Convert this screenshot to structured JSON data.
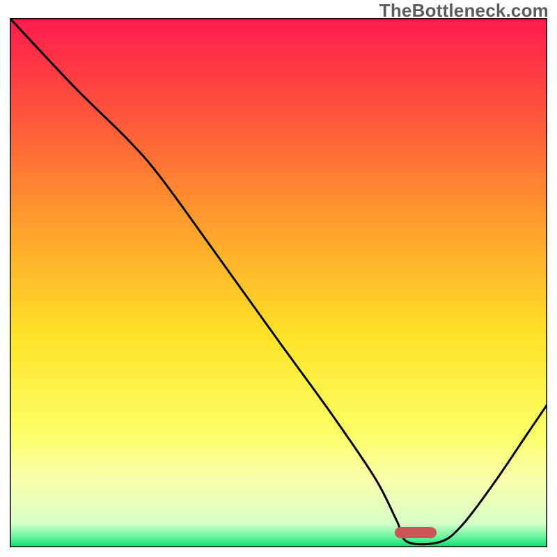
{
  "watermark": "TheBottleneck.com",
  "marker": {
    "x_frac": 0.755,
    "y_frac": 0.972,
    "color": "#cb5658"
  },
  "chart_data": {
    "type": "line",
    "title": "",
    "xlabel": "",
    "ylabel": "",
    "xlim": [
      0,
      1
    ],
    "ylim": [
      0,
      1
    ],
    "background_gradient": {
      "top": "#ff1c4e",
      "mid_top": "#ff8b2d",
      "mid": "#ffe324",
      "mid_low": "#faff60",
      "low_band": "#f6ffa9",
      "bottom": "#00e e? "
    },
    "gradient_stops": [
      {
        "offset": 0.0,
        "color": "#ff1b4d"
      },
      {
        "offset": 0.2,
        "color": "#ff5a3a"
      },
      {
        "offset": 0.4,
        "color": "#ffa22c"
      },
      {
        "offset": 0.6,
        "color": "#ffe227"
      },
      {
        "offset": 0.78,
        "color": "#fbff62"
      },
      {
        "offset": 0.88,
        "color": "#f7ffb0"
      },
      {
        "offset": 0.955,
        "color": "#d4ffc6"
      },
      {
        "offset": 0.98,
        "color": "#6df59e"
      },
      {
        "offset": 1.0,
        "color": "#00e06a"
      }
    ],
    "series": [
      {
        "name": "curve",
        "points": [
          {
            "x": 0.0,
            "y": 1.0
          },
          {
            "x": 0.12,
            "y": 0.87
          },
          {
            "x": 0.22,
            "y": 0.77
          },
          {
            "x": 0.28,
            "y": 0.7
          },
          {
            "x": 0.38,
            "y": 0.56
          },
          {
            "x": 0.5,
            "y": 0.39
          },
          {
            "x": 0.6,
            "y": 0.25
          },
          {
            "x": 0.68,
            "y": 0.13
          },
          {
            "x": 0.72,
            "y": 0.05
          },
          {
            "x": 0.74,
            "y": 0.01
          },
          {
            "x": 0.8,
            "y": 0.01
          },
          {
            "x": 0.84,
            "y": 0.04
          },
          {
            "x": 0.9,
            "y": 0.12
          },
          {
            "x": 0.96,
            "y": 0.21
          },
          {
            "x": 1.0,
            "y": 0.27
          }
        ]
      }
    ],
    "stroke": {
      "color": "#000000",
      "width": 3
    },
    "axis": {
      "color": "#000000",
      "width": 3
    }
  }
}
